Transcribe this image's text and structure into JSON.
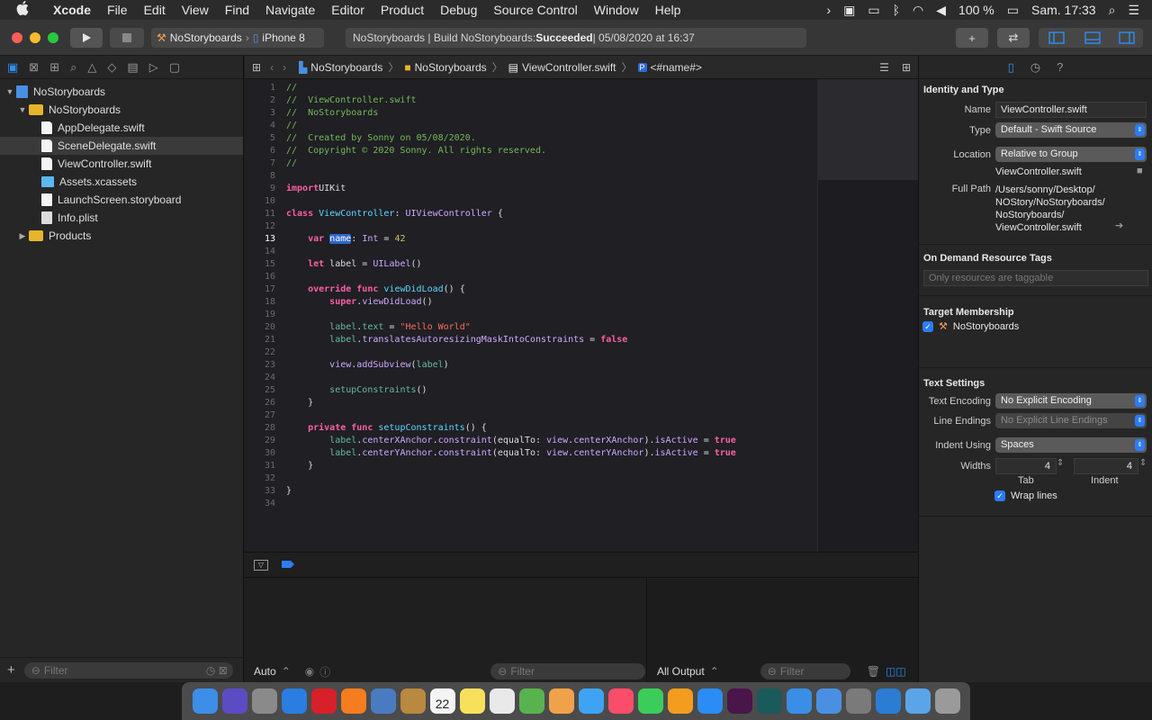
{
  "menubar": {
    "apple": "",
    "items": [
      "Xcode",
      "File",
      "Edit",
      "View",
      "Find",
      "Navigate",
      "Editor",
      "Product",
      "Debug",
      "Source Control",
      "Window",
      "Help"
    ],
    "battery": "100 %",
    "clock": "Sam. 17:33"
  },
  "toolbar": {
    "scheme_target": "NoStoryboards",
    "scheme_device": "iPhone 8",
    "activity_prefix": "NoStoryboards | Build NoStoryboards: ",
    "activity_status": "Succeeded",
    "activity_suffix": " | 05/08/2020 at 16:37",
    "plus": "+"
  },
  "navigator": {
    "tree": [
      {
        "name": "NoStoryboards",
        "type": "proj",
        "indent": 0,
        "disclosure": "▼"
      },
      {
        "name": "NoStoryboards",
        "type": "folder",
        "indent": 1,
        "disclosure": "▼"
      },
      {
        "name": "AppDelegate.swift",
        "type": "swift",
        "indent": 2
      },
      {
        "name": "SceneDelegate.swift",
        "type": "swift",
        "indent": 2,
        "selected": true
      },
      {
        "name": "ViewController.swift",
        "type": "swift",
        "indent": 2
      },
      {
        "name": "Assets.xcassets",
        "type": "assets",
        "indent": 2
      },
      {
        "name": "LaunchScreen.storyboard",
        "type": "sb",
        "indent": 2
      },
      {
        "name": "Info.plist",
        "type": "plist",
        "indent": 2
      },
      {
        "name": "Products",
        "type": "folder",
        "indent": 1,
        "disclosure": "▶"
      }
    ],
    "filter_placeholder": "Filter",
    "add": "+"
  },
  "jumpbar": {
    "crumbs": [
      "NoStoryboards",
      "NoStoryboards",
      "ViewController.swift"
    ],
    "symbol": "<#name#>",
    "symbol_badge": "P"
  },
  "code": {
    "current_line": 13,
    "lines": [
      [
        [
          "c-com",
          "//"
        ]
      ],
      [
        [
          "c-com",
          "//  ViewController.swift"
        ]
      ],
      [
        [
          "c-com",
          "//  NoStoryboards"
        ]
      ],
      [
        [
          "c-com",
          "//"
        ]
      ],
      [
        [
          "c-com",
          "//  Created by Sonny on 05/08/2020."
        ]
      ],
      [
        [
          "c-com",
          "//  Copyright © 2020 Sonny. All rights reserved."
        ]
      ],
      [
        [
          "c-com",
          "//"
        ]
      ],
      [],
      [
        [
          "c-kw",
          "import"
        ],
        [
          "",
          "UIKit"
        ]
      ],
      [],
      [
        [
          "c-kw",
          "class"
        ],
        [
          "",
          " "
        ],
        [
          "c-ty",
          "ViewController"
        ],
        [
          "",
          ": "
        ],
        [
          "c-ty2",
          "UIViewController"
        ],
        [
          "",
          " {"
        ]
      ],
      [],
      [
        [
          "",
          "    "
        ],
        [
          "c-kw",
          "var"
        ],
        [
          "",
          " "
        ],
        [
          "c-hl",
          "name"
        ],
        [
          "",
          ": "
        ],
        [
          "c-ty2",
          "Int"
        ],
        [
          "",
          " = "
        ],
        [
          "c-num",
          "42"
        ]
      ],
      [],
      [
        [
          "",
          "    "
        ],
        [
          "c-kw",
          "let"
        ],
        [
          "",
          " label = "
        ],
        [
          "c-ty2",
          "UILabel"
        ],
        [
          "",
          "()"
        ]
      ],
      [],
      [
        [
          "",
          "    "
        ],
        [
          "c-kw",
          "override func"
        ],
        [
          "",
          " "
        ],
        [
          "c-ty",
          "viewDidLoad"
        ],
        [
          "",
          "() {"
        ]
      ],
      [
        [
          "",
          "        "
        ],
        [
          "c-kw",
          "super"
        ],
        [
          "",
          "."
        ],
        [
          "c-ty2",
          "viewDidLoad"
        ],
        [
          "",
          "()"
        ]
      ],
      [],
      [
        [
          "",
          "        "
        ],
        [
          "c-fn",
          "label"
        ],
        [
          "",
          "."
        ],
        [
          "c-fn",
          "text"
        ],
        [
          "",
          " = "
        ],
        [
          "c-str",
          "\"Hello World\""
        ]
      ],
      [
        [
          "",
          "        "
        ],
        [
          "c-fn",
          "label"
        ],
        [
          "",
          "."
        ],
        [
          "c-ty2",
          "translatesAutoresizingMaskIntoConstraints"
        ],
        [
          "",
          " = "
        ],
        [
          "c-kw",
          "false"
        ]
      ],
      [],
      [
        [
          "",
          "        "
        ],
        [
          "c-ty2",
          "view"
        ],
        [
          "",
          "."
        ],
        [
          "c-ty2",
          "addSubview"
        ],
        [
          "",
          "("
        ],
        [
          "c-fn",
          "label"
        ],
        [
          "",
          ")"
        ]
      ],
      [],
      [
        [
          "",
          "        "
        ],
        [
          "c-fn",
          "setupConstraints"
        ],
        [
          "",
          "()"
        ]
      ],
      [
        [
          "",
          "    }"
        ]
      ],
      [],
      [
        [
          "",
          "    "
        ],
        [
          "c-kw",
          "private func"
        ],
        [
          "",
          " "
        ],
        [
          "c-ty",
          "setupConstraints"
        ],
        [
          "",
          "() {"
        ]
      ],
      [
        [
          "",
          "        "
        ],
        [
          "c-fn",
          "label"
        ],
        [
          "",
          "."
        ],
        [
          "c-ty2",
          "centerXAnchor"
        ],
        [
          "",
          "."
        ],
        [
          "c-ty2",
          "constraint"
        ],
        [
          "",
          "(equalTo: "
        ],
        [
          "c-ty2",
          "view"
        ],
        [
          "",
          "."
        ],
        [
          "c-ty2",
          "centerXAnchor"
        ],
        [
          "",
          ")."
        ],
        [
          "c-ty2",
          "isActive"
        ],
        [
          "",
          " = "
        ],
        [
          "c-kw",
          "true"
        ]
      ],
      [
        [
          "",
          "        "
        ],
        [
          "c-fn",
          "label"
        ],
        [
          "",
          "."
        ],
        [
          "c-ty2",
          "centerYAnchor"
        ],
        [
          "",
          "."
        ],
        [
          "c-ty2",
          "constraint"
        ],
        [
          "",
          "(equalTo: "
        ],
        [
          "c-ty2",
          "view"
        ],
        [
          "",
          "."
        ],
        [
          "c-ty2",
          "centerYAnchor"
        ],
        [
          "",
          ")."
        ],
        [
          "c-ty2",
          "isActive"
        ],
        [
          "",
          " = "
        ],
        [
          "c-kw",
          "true"
        ]
      ],
      [
        [
          "",
          "    }"
        ]
      ],
      [],
      [
        [
          "",
          "}"
        ]
      ],
      []
    ]
  },
  "debug": {
    "auto": "Auto",
    "filter_placeholder": "Filter",
    "output": "All Output",
    "filter2_placeholder": "Filter"
  },
  "inspector": {
    "identity_title": "Identity and Type",
    "name_label": "Name",
    "name_value": "ViewController.swift",
    "type_label": "Type",
    "type_value": "Default - Swift Source",
    "location_label": "Location",
    "location_value": "Relative to Group",
    "location_file": "ViewController.swift",
    "fullpath_label": "Full Path",
    "fullpath_lines": [
      "/Users/sonny/Desktop/",
      "NOStory/NoStoryboards/",
      "NoStoryboards/",
      "ViewController.swift"
    ],
    "odr_title": "On Demand Resource Tags",
    "odr_placeholder": "Only resources are taggable",
    "target_title": "Target Membership",
    "target_name": "NoStoryboards",
    "text_title": "Text Settings",
    "encoding_label": "Text Encoding",
    "encoding_value": "No Explicit Encoding",
    "endings_label": "Line Endings",
    "endings_value": "No Explicit Line Endings",
    "indent_label": "Indent Using",
    "indent_value": "Spaces",
    "widths_label": "Widths",
    "tab_value": "4",
    "indent_width_value": "4",
    "tab_caption": "Tab",
    "indent_caption": "Indent",
    "wrap_label": "Wrap lines"
  },
  "dock": {
    "calendar_day": "22",
    "colors": [
      "#3d8ee6",
      "#5b4cc4",
      "#8a8a8a",
      "#2a7de1",
      "#d8202a",
      "#f57c1f",
      "#4a7bc1",
      "#b8893e",
      "#f4f4f4",
      "#f7e15c",
      "#e9e9e9",
      "#58b24d",
      "#f0a24b",
      "#3fa3f5",
      "#fa4d6a",
      "#3ccc5a",
      "#f39c1f",
      "#2b8cf5",
      "#4a154b",
      "#1a5a5a",
      "#3a8ee6",
      "#4a90e2",
      "#7a7a7a",
      "#2b7cd3",
      "#5aa5e8",
      "#9a9a9a"
    ]
  }
}
